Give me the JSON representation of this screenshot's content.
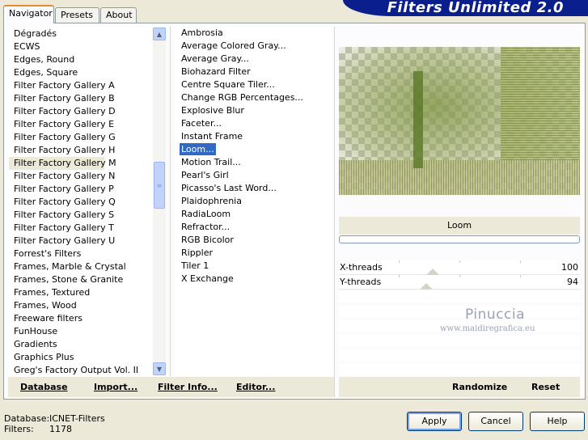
{
  "app": {
    "title": "Filters Unlimited 2.0"
  },
  "tabs": [
    {
      "label": "Navigator",
      "active": true
    },
    {
      "label": "Presets",
      "active": false
    },
    {
      "label": "About",
      "active": false
    }
  ],
  "categories": {
    "selected": "Filter Factory Gallery M",
    "items": [
      "Dégradés",
      "ECWS",
      "Edges, Round",
      "Edges, Square",
      "Filter Factory Gallery A",
      "Filter Factory Gallery B",
      "Filter Factory Gallery D",
      "Filter Factory Gallery E",
      "Filter Factory Gallery G",
      "Filter Factory Gallery H",
      "Filter Factory Gallery M",
      "Filter Factory Gallery N",
      "Filter Factory Gallery P",
      "Filter Factory Gallery Q",
      "Filter Factory Gallery S",
      "Filter Factory Gallery T",
      "Filter Factory Gallery U",
      "Forrest's Filters",
      "Frames, Marble & Crystal",
      "Frames, Stone & Granite",
      "Frames, Textured",
      "Frames, Wood",
      "Freeware filters",
      "FunHouse",
      "Gradients",
      "Graphics Plus",
      "Greg's Factory Output Vol. II"
    ]
  },
  "filters": {
    "selected": "Loom...",
    "items": [
      "Ambrosia",
      "Average Colored Gray...",
      "Average Gray...",
      "Biohazard Filter",
      "Centre Square Tiler...",
      "Change RGB Percentages...",
      "Explosive Blur",
      "Faceter...",
      "Instant Frame",
      "Loom...",
      "Motion Trail...",
      "Pearl's Girl",
      "Picasso's Last Word...",
      "Plaidophrenia",
      "RadiaLoom",
      "Refractor...",
      "RGB Bicolor",
      "Rippler",
      "Tiler 1",
      "X Exchange"
    ]
  },
  "left_buttons": {
    "database": "Database",
    "import": "Import...",
    "filter_info": "Filter Info...",
    "editor": "Editor..."
  },
  "preview": {
    "filter_name": "Loom"
  },
  "params": [
    {
      "label": "X-threads",
      "value": "100"
    },
    {
      "label": "Y-threads",
      "value": "94"
    }
  ],
  "right_buttons": {
    "randomize": "Randomize",
    "reset": "Reset"
  },
  "watermark": {
    "line1": "Pinuccia",
    "line2": "www.maidiregrafica.eu"
  },
  "status": {
    "database_label": "Database:",
    "database_value": "ICNET-Filters",
    "filters_label": "Filters:",
    "filters_value": "1178"
  },
  "dialog_buttons": {
    "apply": "Apply",
    "cancel": "Cancel",
    "help": "Help"
  },
  "colors": {
    "banner": "#0a1e8c",
    "selection": "#316ac5",
    "preview_green": "#8a9a4f"
  }
}
